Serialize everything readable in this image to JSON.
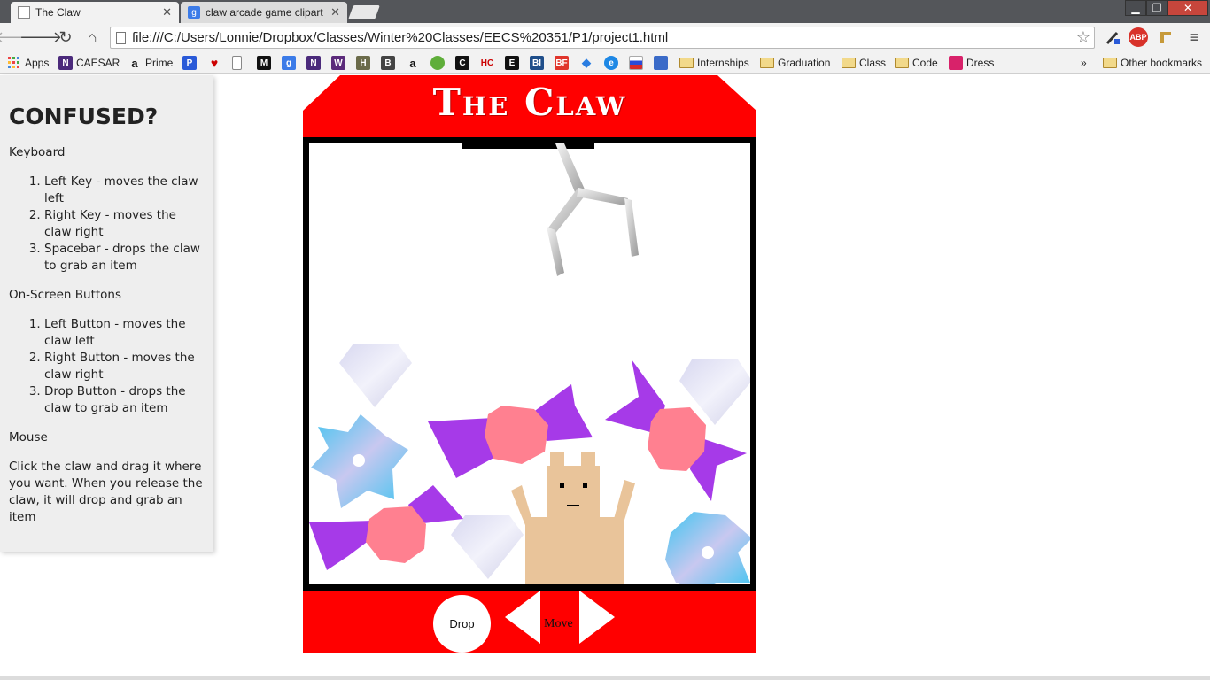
{
  "browser": {
    "tabs": [
      {
        "title": "The Claw",
        "active": true
      },
      {
        "title": "claw arcade game clipart -",
        "active": false
      }
    ],
    "url": "file:///C:/Users/Lonnie/Dropbox/Classes/Winter%20Classes/EECS%20351/P1/project1.html",
    "bookmarks": {
      "apps": "Apps",
      "caesar": "CAESAR",
      "prime": "Prime",
      "internships": "Internships",
      "graduation": "Graduation",
      "class": "Class",
      "code": "Code",
      "dress": "Dress",
      "overflow": "»",
      "other": "Other bookmarks"
    },
    "extension_abp": "ABP"
  },
  "help": {
    "title": "CONFUSED?",
    "keyboard_heading": "Keyboard",
    "keyboard_items": [
      "Left Key - moves the claw left",
      "Right Key - moves the claw right",
      "Spacebar - drops the claw to grab an item"
    ],
    "buttons_heading": "On-Screen Buttons",
    "buttons_items": [
      "Left Button - moves the claw left",
      "Right Button - moves the claw right",
      "Drop Button - drops the claw to grab an item"
    ],
    "mouse_heading": "Mouse",
    "mouse_text": "Click the claw and drag it where you want. When you release the claw, it will drop and grab an item"
  },
  "game": {
    "title": "The Claw",
    "drop_label": "Drop",
    "move_label": "Move",
    "colors": {
      "machine_red": "#ff0000",
      "candy_wrapper": "#a63ae8",
      "candy_center": "#ff8090",
      "bear": "#e9c49a",
      "pinwheel": "#3ec4f0",
      "diamond": "#e4e4f4"
    },
    "prizes": [
      "diamond-prize",
      "pinwheel-prize",
      "candy-prize",
      "teddy-bear-prize"
    ]
  }
}
